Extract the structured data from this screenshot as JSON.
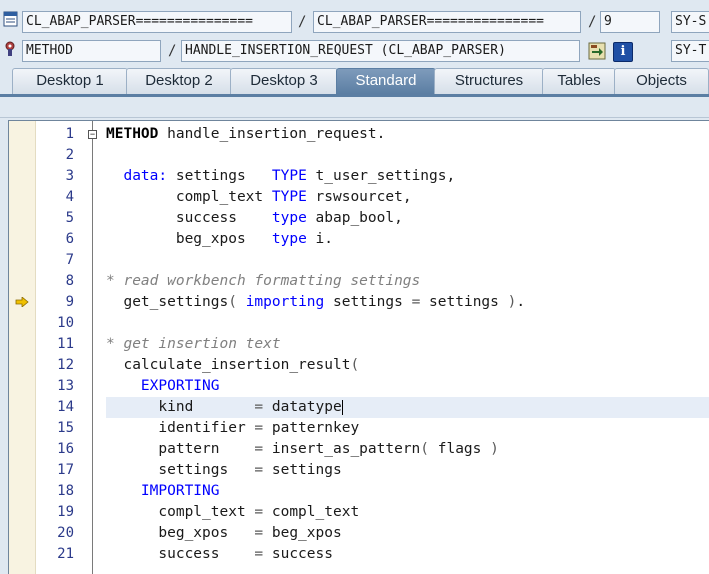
{
  "header": {
    "program_field": "CL_ABAP_PARSER===============",
    "include_field": "CL_ABAP_PARSER===============",
    "line_field": "9",
    "sysvar1": "SY-S",
    "type_field": "METHOD",
    "object_field": "HANDLE_INSERTION_REQUEST (CL_ABAP_PARSER)",
    "sysvar2": "SY-T",
    "separators": [
      "/",
      "/",
      "/"
    ],
    "info_icon_label": "i"
  },
  "tabs": [
    {
      "label": "Desktop 1"
    },
    {
      "label": "Desktop 2"
    },
    {
      "label": "Desktop 3"
    },
    {
      "label": "Standard"
    },
    {
      "label": "Structures"
    },
    {
      "label": "Tables"
    },
    {
      "label": "Objects"
    }
  ],
  "active_tab": "Standard",
  "editor": {
    "current_line": 9,
    "lines": [
      {
        "n": "1",
        "parts": [
          [
            "kwb",
            "METHOD"
          ],
          [
            "",
            " handle_insertion_request."
          ]
        ]
      },
      {
        "n": "2",
        "parts": []
      },
      {
        "n": "3",
        "parts": [
          [
            "",
            "  "
          ],
          [
            "kw",
            "data:"
          ],
          [
            "",
            " settings   "
          ],
          [
            "kw",
            "TYPE"
          ],
          [
            "",
            " t_user_settings,"
          ]
        ]
      },
      {
        "n": "4",
        "parts": [
          [
            "",
            "        compl_text "
          ],
          [
            "kw",
            "TYPE"
          ],
          [
            "",
            " rswsourcet,"
          ]
        ]
      },
      {
        "n": "5",
        "parts": [
          [
            "",
            "        success    "
          ],
          [
            "kw",
            "type"
          ],
          [
            "",
            " abap_bool,"
          ]
        ]
      },
      {
        "n": "6",
        "parts": [
          [
            "",
            "        beg_xpos   "
          ],
          [
            "kw",
            "type"
          ],
          [
            "",
            " i."
          ]
        ]
      },
      {
        "n": "7",
        "parts": []
      },
      {
        "n": "8",
        "parts": [
          [
            "cm",
            "* read workbench formatting settings"
          ]
        ]
      },
      {
        "n": "9",
        "parts": [
          [
            "",
            "  get_settings"
          ],
          [
            "op",
            "("
          ],
          [
            "",
            " "
          ],
          [
            "kw",
            "importing"
          ],
          [
            "",
            " settings "
          ],
          [
            "op",
            "="
          ],
          [
            "",
            " settings "
          ],
          [
            "op",
            ")"
          ],
          [
            "",
            "."
          ]
        ]
      },
      {
        "n": "10",
        "parts": []
      },
      {
        "n": "11",
        "parts": [
          [
            "cm",
            "* get insertion text"
          ]
        ]
      },
      {
        "n": "12",
        "parts": [
          [
            "",
            "  calculate_insertion_result"
          ],
          [
            "op",
            "("
          ]
        ]
      },
      {
        "n": "13",
        "parts": [
          [
            "",
            "    "
          ],
          [
            "kw",
            "EXPORTING"
          ]
        ]
      },
      {
        "n": "14",
        "parts": [
          [
            "",
            "      kind       "
          ],
          [
            "op",
            "="
          ],
          [
            "",
            " datatype"
          ]
        ]
      },
      {
        "n": "15",
        "parts": [
          [
            "",
            "      identifier "
          ],
          [
            "op",
            "="
          ],
          [
            "",
            " patternkey"
          ]
        ]
      },
      {
        "n": "16",
        "parts": [
          [
            "",
            "      pattern    "
          ],
          [
            "op",
            "="
          ],
          [
            "",
            " insert_as_pattern"
          ],
          [
            "op",
            "("
          ],
          [
            "",
            " flags "
          ],
          [
            "op",
            ")"
          ]
        ]
      },
      {
        "n": "17",
        "parts": [
          [
            "",
            "      settings   "
          ],
          [
            "op",
            "="
          ],
          [
            "",
            " settings"
          ]
        ]
      },
      {
        "n": "18",
        "parts": [
          [
            "",
            "    "
          ],
          [
            "kw",
            "IMPORTING"
          ]
        ]
      },
      {
        "n": "19",
        "parts": [
          [
            "",
            "      compl_text "
          ],
          [
            "op",
            "="
          ],
          [
            "",
            " compl_text"
          ]
        ]
      },
      {
        "n": "20",
        "parts": [
          [
            "",
            "      beg_xpos   "
          ],
          [
            "op",
            "="
          ],
          [
            "",
            " beg_xpos"
          ]
        ]
      },
      {
        "n": "21",
        "parts": [
          [
            "",
            "      success    "
          ],
          [
            "op",
            "="
          ],
          [
            "",
            " success"
          ]
        ]
      }
    ]
  },
  "colors": {
    "keyword": "#0000ff",
    "comment": "#808080",
    "line_number": "#2b3a8a",
    "active_tab": "#5b7ea3",
    "marker_column": "#f8f3e1",
    "current_line_arrow": "#f0c000"
  }
}
